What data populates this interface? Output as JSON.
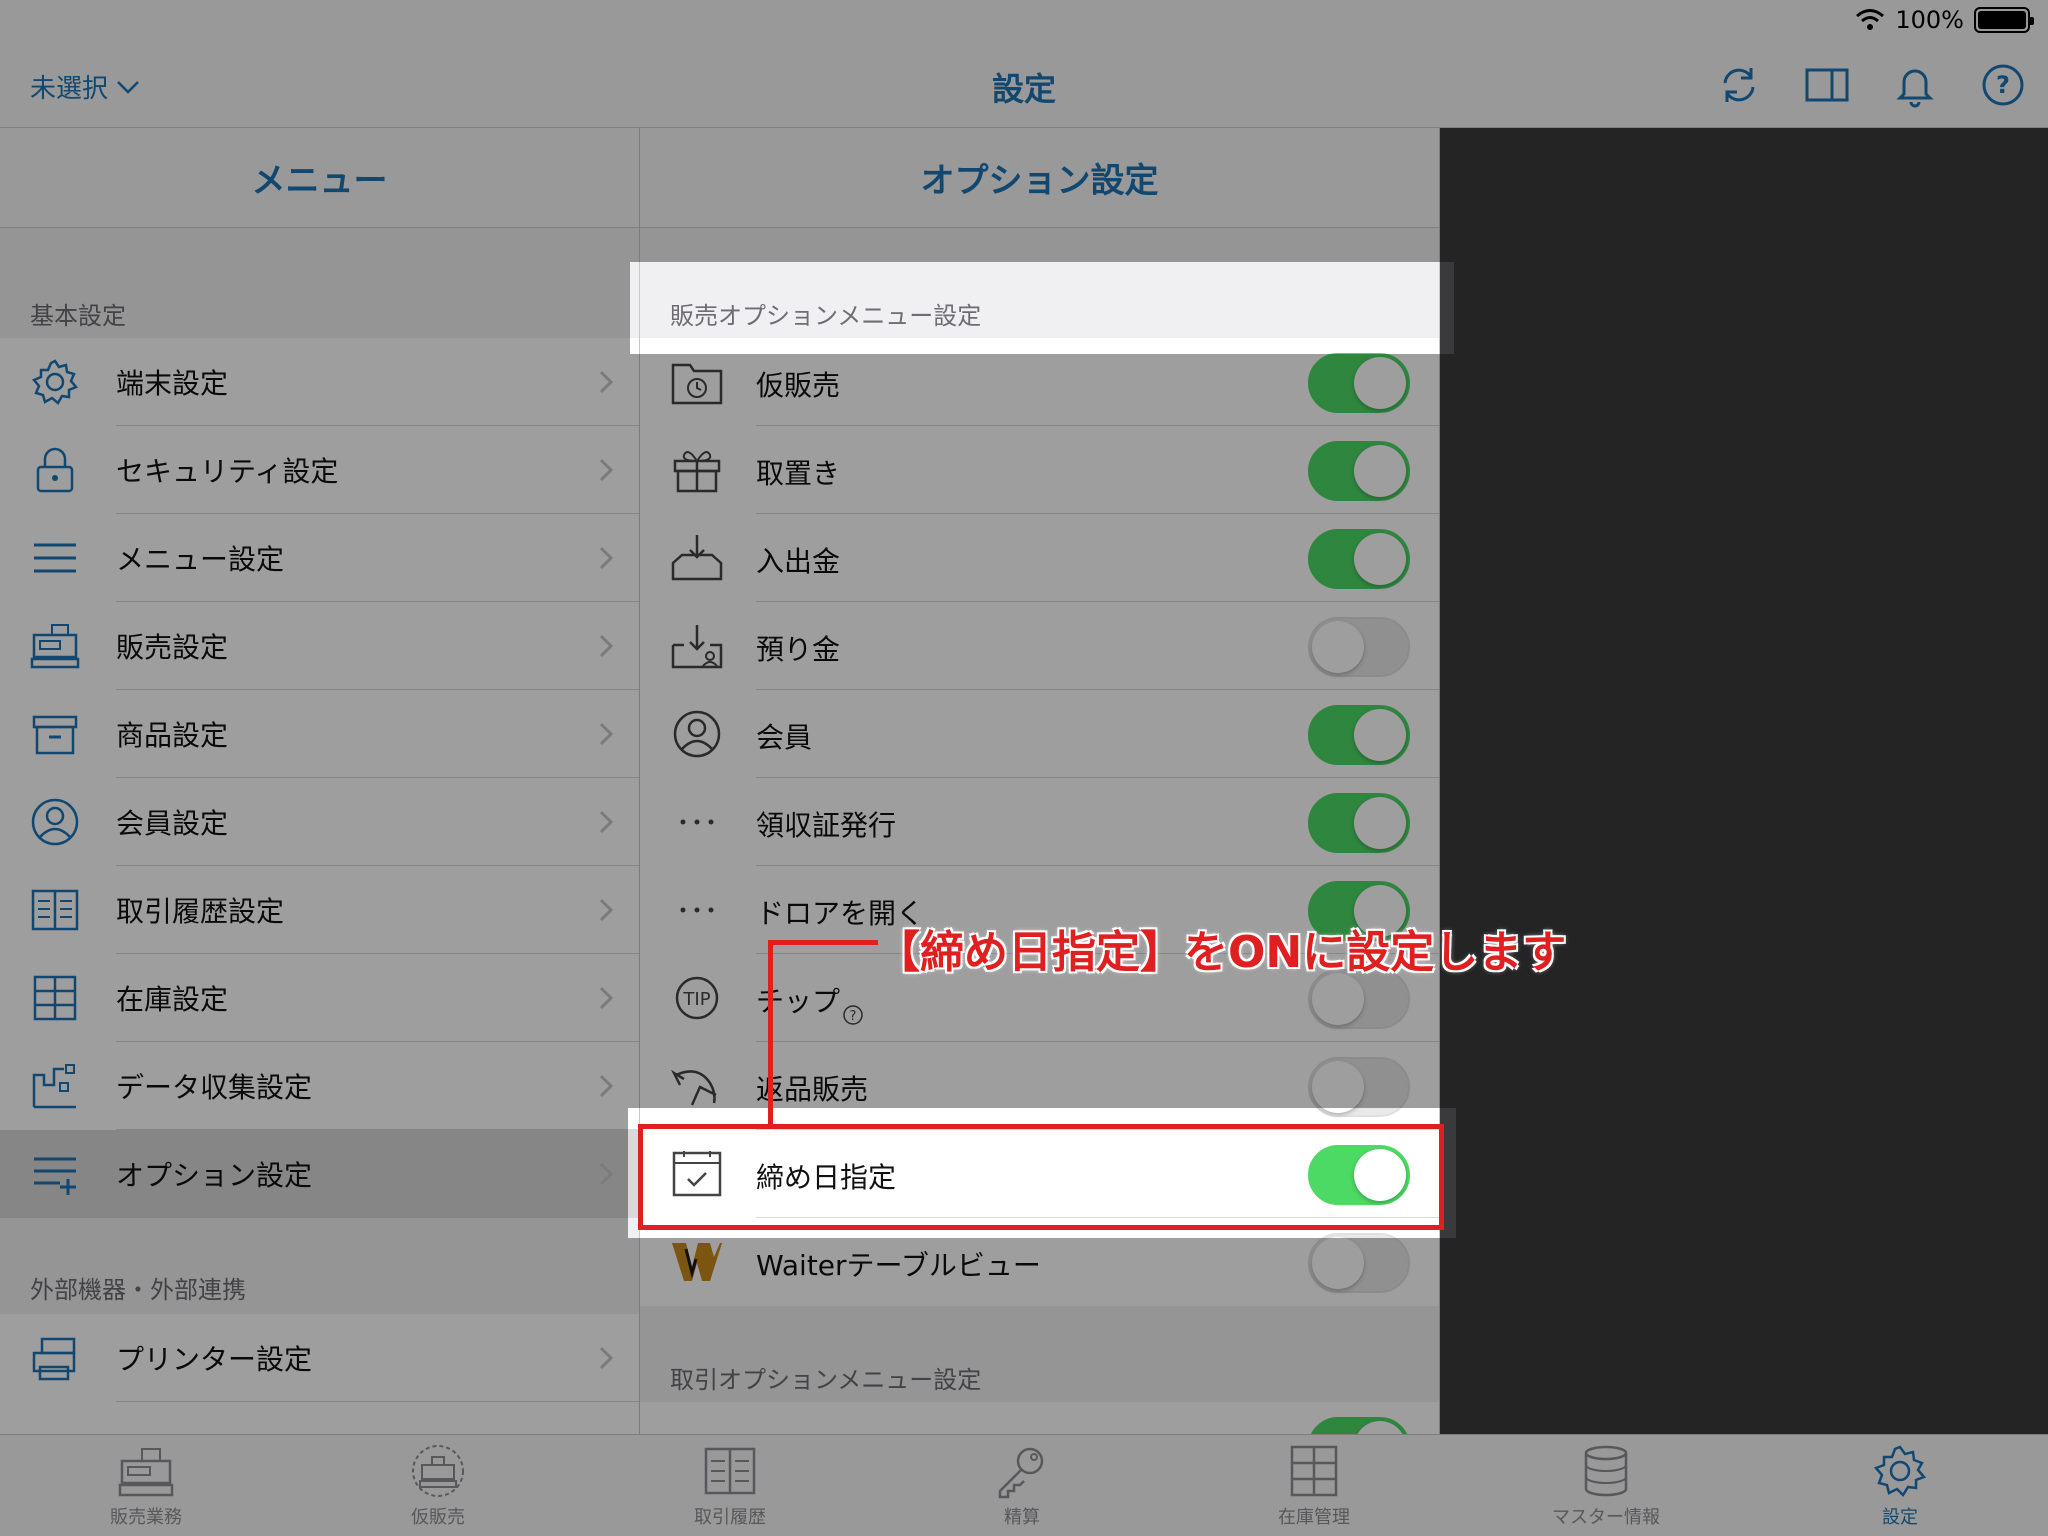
{
  "status": {
    "battery": "100%"
  },
  "nav": {
    "left_label": "未選択",
    "title": "設定"
  },
  "left_panel": {
    "title": "メニュー",
    "sections": [
      {
        "title": "基本設定",
        "items": [
          {
            "label": "端末設定",
            "icon": "gear-icon"
          },
          {
            "label": "セキュリティ設定",
            "icon": "lock-icon"
          },
          {
            "label": "メニュー設定",
            "icon": "menu-icon"
          },
          {
            "label": "販売設定",
            "icon": "register-icon"
          },
          {
            "label": "商品設定",
            "icon": "box-icon"
          },
          {
            "label": "会員設定",
            "icon": "person-icon"
          },
          {
            "label": "取引履歴設定",
            "icon": "book-icon"
          },
          {
            "label": "在庫設定",
            "icon": "shelf-icon"
          },
          {
            "label": "データ収集設定",
            "icon": "data-icon"
          },
          {
            "label": "オプション設定",
            "icon": "menu-plus-icon",
            "selected": true
          }
        ]
      },
      {
        "title": "外部機器・外部連携",
        "items": [
          {
            "label": "プリンター設定",
            "icon": "printer-icon"
          }
        ]
      }
    ]
  },
  "options_panel": {
    "title": "オプション設定",
    "section_sales": "販売オプションメニュー設定",
    "items": [
      {
        "label": "仮販売",
        "icon": "folder-clock-icon",
        "on": true
      },
      {
        "label": "取置き",
        "icon": "gift-icon",
        "on": true
      },
      {
        "label": "入出金",
        "icon": "tray-in-icon",
        "on": true
      },
      {
        "label": "預り金",
        "icon": "tray-person-icon",
        "on": false
      },
      {
        "label": "会員",
        "icon": "person-icon",
        "on": true
      },
      {
        "label": "領収証発行",
        "icon": "more-icon",
        "on": true
      },
      {
        "label": "ドロアを開く",
        "icon": "more-icon",
        "on": true
      },
      {
        "label": "チップ",
        "icon": "tip-icon",
        "on": false
      },
      {
        "label": "返品販売",
        "icon": "return-icon",
        "on": false
      },
      {
        "label": "締め日指定",
        "icon": "calendar-check-icon",
        "on": true
      },
      {
        "label": "Waiterテーブルビュー",
        "icon": "waiter-logo-icon",
        "on": false
      }
    ],
    "section_transaction": "取引オプションメニュー設定"
  },
  "tabbar": {
    "tabs": [
      {
        "label": "販売業務",
        "icon": "register-icon"
      },
      {
        "label": "仮販売",
        "icon": "temp-sale-icon"
      },
      {
        "label": "取引履歴",
        "icon": "book-icon"
      },
      {
        "label": "精算",
        "icon": "key-icon"
      },
      {
        "label": "在庫管理",
        "icon": "shelf-icon"
      },
      {
        "label": "マスター情報",
        "icon": "database-icon"
      },
      {
        "label": "設定",
        "icon": "gear-icon",
        "active": true
      }
    ]
  },
  "annotation": {
    "text": "【締め日指定】をONに設定します"
  },
  "colors": {
    "accent": "#1e74b5",
    "toggle_on": "#4cd964",
    "annotation": "#e02020"
  }
}
